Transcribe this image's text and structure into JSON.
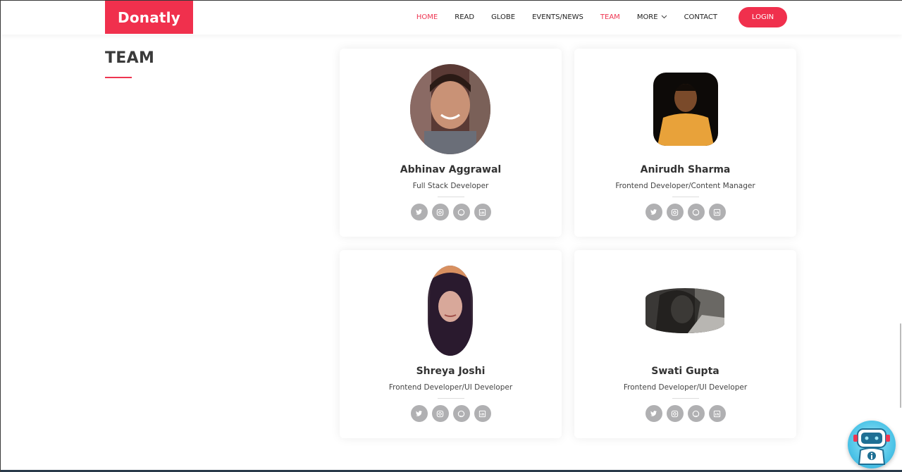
{
  "brand": {
    "logo_text": "Donatly",
    "accent": "#f0304d"
  },
  "nav": {
    "items": [
      {
        "label": "HOME",
        "active": true
      },
      {
        "label": "READ",
        "active": false
      },
      {
        "label": "GLOBE",
        "active": false
      },
      {
        "label": "EVENTS/NEWS",
        "active": false
      },
      {
        "label": "TEAM",
        "active": true
      },
      {
        "label": "MORE",
        "active": false,
        "dropdown": true
      }
    ],
    "contact_label": "CONTACT",
    "login_label": "LOGIN"
  },
  "section": {
    "title": "TEAM"
  },
  "team": [
    {
      "name": "Abhinav Aggrawal",
      "role": "Full Stack Developer",
      "socials": [
        "twitter-icon",
        "instagram-icon",
        "github-icon",
        "linkedin-icon"
      ]
    },
    {
      "name": "Anirudh Sharma",
      "role": "Frontend Developer/Content Manager",
      "socials": [
        "twitter-icon",
        "instagram-icon",
        "github-icon",
        "linkedin-icon"
      ]
    },
    {
      "name": "Shreya Joshi",
      "role": "Frontend Developer/UI Developer",
      "socials": [
        "twitter-icon",
        "instagram-icon",
        "github-icon",
        "linkedin-icon"
      ]
    },
    {
      "name": "Swati Gupta",
      "role": "Frontend Developer/UI Developer",
      "socials": [
        "twitter-icon",
        "instagram-icon",
        "github-icon",
        "linkedin-icon"
      ]
    }
  ],
  "colors": {
    "social_bg": "#b0b0b2",
    "heading": "#3a3a3a"
  }
}
